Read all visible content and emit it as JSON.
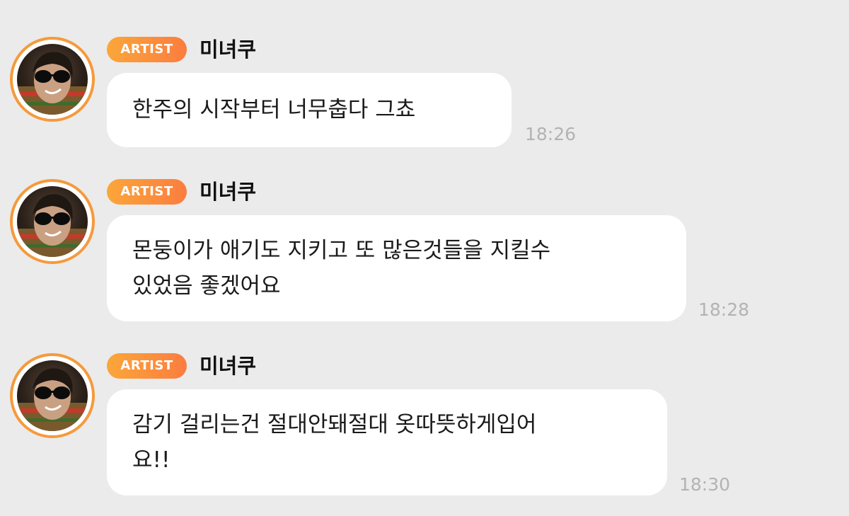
{
  "colors": {
    "background": "#ebebeb",
    "badge_start": "#fba63a",
    "badge_end": "#fb7d3f",
    "avatar_ring": "#f59a3c",
    "bubble": "#ffffff",
    "time": "#b3b3b3"
  },
  "messages": [
    {
      "badge": "ARTIST",
      "sender": "미녀쿠",
      "lines": [
        "한주의 시작부터 너무춥다 그쵸"
      ],
      "time": "18:26",
      "avatar_icon": "avatar-photo"
    },
    {
      "badge": "ARTIST",
      "sender": "미녀쿠",
      "lines": [
        "몬둥이가 애기도 지키고 또 많은것들을 지킬수",
        "있었음 좋겠어요"
      ],
      "time": "18:28",
      "avatar_icon": "avatar-photo"
    },
    {
      "badge": "ARTIST",
      "sender": "미녀쿠",
      "lines": [
        "감기 걸리는건 절대안돼절대 옷따뜻하게입어",
        "요!!"
      ],
      "time": "18:30",
      "avatar_icon": "avatar-photo"
    }
  ]
}
